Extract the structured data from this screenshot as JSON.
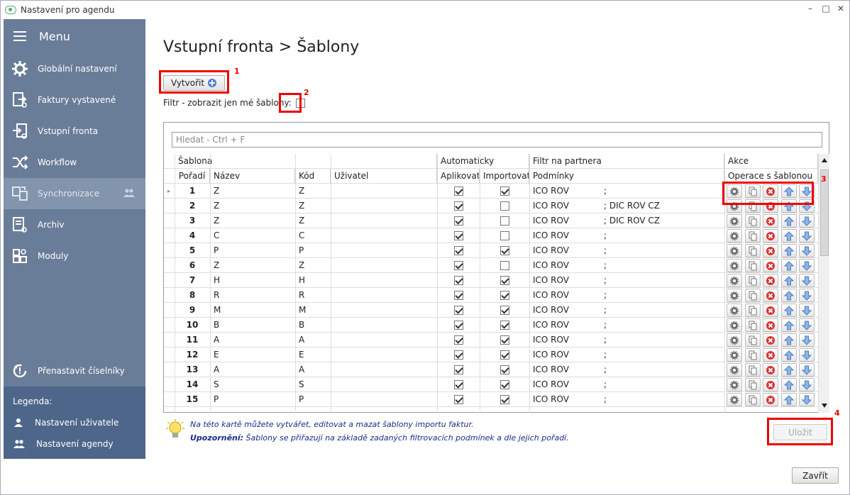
{
  "window": {
    "title": "Nastavení pro agendu"
  },
  "sidebar": {
    "menu_label": "Menu",
    "items": [
      {
        "label": "Globální nastavení",
        "icon": "gear-icon"
      },
      {
        "label": "Faktury vystavené",
        "icon": "invoice-issued-icon"
      },
      {
        "label": "Vstupní fronta",
        "icon": "input-queue-icon"
      },
      {
        "label": "Workflow",
        "icon": "workflow-icon"
      },
      {
        "label": "Synchronizace",
        "icon": "sync-icon"
      },
      {
        "label": "Archiv",
        "icon": "archive-icon"
      },
      {
        "label": "Moduly",
        "icon": "modules-icon"
      }
    ],
    "reset_label": "Přenastavit číselníky",
    "legend": {
      "title": "Legenda:",
      "items": [
        "Nastavení uživatele",
        "Nastavení agendy"
      ]
    }
  },
  "page": {
    "title": "Vstupní fronta > Šablony",
    "create_label": "Vytvořit",
    "filter_label": "Filtr - zobrazit jen mé šablony:",
    "filter_checked": false,
    "search_placeholder": "Hledat - Ctrl + F",
    "save_label": "Uložit",
    "close_label": "Zavřít"
  },
  "annotations": [
    "1",
    "2",
    "3",
    "4"
  ],
  "grid": {
    "groups": [
      "Šablona",
      "Automaticky",
      "Filtr na partnera",
      "Akce"
    ],
    "columns": [
      "Pořadí",
      "Název",
      "Kód",
      "Uživatel",
      "Aplikovat",
      "Importovat",
      "Podmínky",
      "Operace s šablonou"
    ],
    "rows": [
      {
        "n": "1",
        "name": "Z",
        "code": "Z",
        "user": "",
        "apply": true,
        "import": true,
        "cond": "ICO ROV",
        "extra": ";"
      },
      {
        "n": "2",
        "name": "Z",
        "code": "Z",
        "user": "",
        "apply": true,
        "import": false,
        "cond": "ICO ROV",
        "extra": "; DIC ROV CZ"
      },
      {
        "n": "3",
        "name": "Z",
        "code": "Z",
        "user": "",
        "apply": true,
        "import": false,
        "cond": "ICO ROV",
        "extra": "; DIC ROV CZ"
      },
      {
        "n": "4",
        "name": "C",
        "code": "C",
        "user": "",
        "apply": true,
        "import": false,
        "cond": "ICO ROV",
        "extra": ";"
      },
      {
        "n": "5",
        "name": "P",
        "code": "P",
        "user": "",
        "apply": true,
        "import": true,
        "cond": "ICO ROV",
        "extra": ";"
      },
      {
        "n": "6",
        "name": "Z",
        "code": "Z",
        "user": "",
        "apply": true,
        "import": false,
        "cond": "ICO ROV",
        "extra": ";"
      },
      {
        "n": "7",
        "name": "H",
        "code": "H",
        "user": "",
        "apply": true,
        "import": true,
        "cond": "ICO ROV",
        "extra": ";"
      },
      {
        "n": "8",
        "name": "R",
        "code": "R",
        "user": "",
        "apply": true,
        "import": true,
        "cond": "ICO ROV",
        "extra": ";"
      },
      {
        "n": "9",
        "name": "M",
        "code": "M",
        "user": "",
        "apply": true,
        "import": true,
        "cond": "ICO ROV",
        "extra": ";"
      },
      {
        "n": "10",
        "name": "B",
        "code": "B",
        "user": "",
        "apply": true,
        "import": true,
        "cond": "ICO ROV",
        "extra": ";"
      },
      {
        "n": "11",
        "name": "A",
        "code": "A",
        "user": "",
        "apply": true,
        "import": true,
        "cond": "ICO ROV",
        "extra": ";"
      },
      {
        "n": "12",
        "name": "E",
        "code": "E",
        "user": "",
        "apply": true,
        "import": true,
        "cond": "ICO ROV",
        "extra": ";"
      },
      {
        "n": "13",
        "name": "A",
        "code": "A",
        "user": "",
        "apply": true,
        "import": true,
        "cond": "ICO ROV",
        "extra": ";"
      },
      {
        "n": "14",
        "name": "S",
        "code": "S",
        "user": "",
        "apply": true,
        "import": true,
        "cond": "ICO ROV",
        "extra": ";"
      },
      {
        "n": "15",
        "name": "P",
        "code": "P",
        "user": "",
        "apply": true,
        "import": true,
        "cond": "ICO ROV",
        "extra": ";"
      }
    ]
  },
  "info": {
    "line1": "Na této kartě můžete vytvářet, editovat a mazat šablony importu faktur.",
    "warn_label": "Upozornění:",
    "line2": "Šablony se přiřazují na základě zadaných filtrovacích podmínek a dle jejich pořadí."
  }
}
